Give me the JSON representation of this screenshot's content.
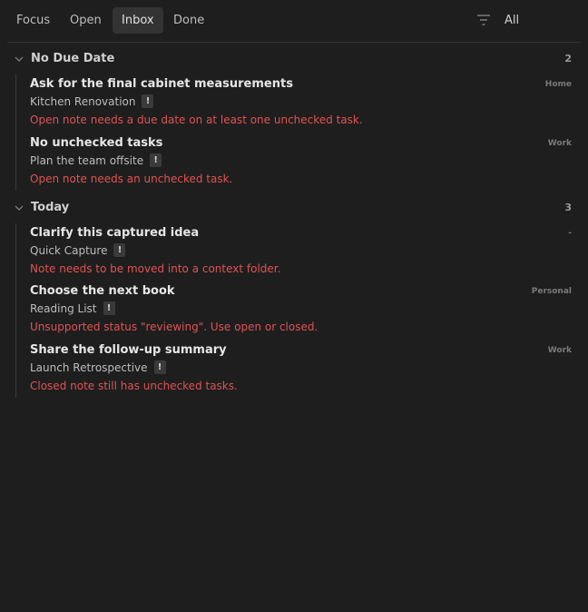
{
  "toolbar": {
    "tabs": [
      {
        "label": "Focus",
        "active": false
      },
      {
        "label": "Open",
        "active": false
      },
      {
        "label": "Inbox",
        "active": true
      },
      {
        "label": "Done",
        "active": false
      }
    ],
    "filter_icon": "filter-icon",
    "filter_value": "All"
  },
  "groups": [
    {
      "title": "No Due Date",
      "count": "2",
      "items": [
        {
          "title": "Ask for the final cabinet measurements",
          "context": "Home",
          "note": "Kitchen Renovation",
          "badge": "!",
          "error": "Open note needs a due date on at least one unchecked task."
        },
        {
          "title": "No unchecked tasks",
          "context": "Work",
          "note": "Plan the team offsite",
          "badge": "!",
          "error": "Open note needs an unchecked task."
        }
      ]
    },
    {
      "title": "Today",
      "count": "3",
      "items": [
        {
          "title": "Clarify this captured idea",
          "context": "-",
          "note": "Quick Capture",
          "badge": "!",
          "error": "Note needs to be moved into a context folder."
        },
        {
          "title": "Choose the next book",
          "context": "Personal",
          "note": "Reading List",
          "badge": "!",
          "error": "Unsupported status \"reviewing\". Use open or closed."
        },
        {
          "title": "Share the follow-up summary",
          "context": "Work",
          "note": "Launch Retrospective",
          "badge": "!",
          "error": "Closed note still has unchecked tasks."
        }
      ]
    }
  ],
  "colors": {
    "background": "#1e1e1e",
    "error": "#e05252",
    "active_tab": "#333333"
  }
}
